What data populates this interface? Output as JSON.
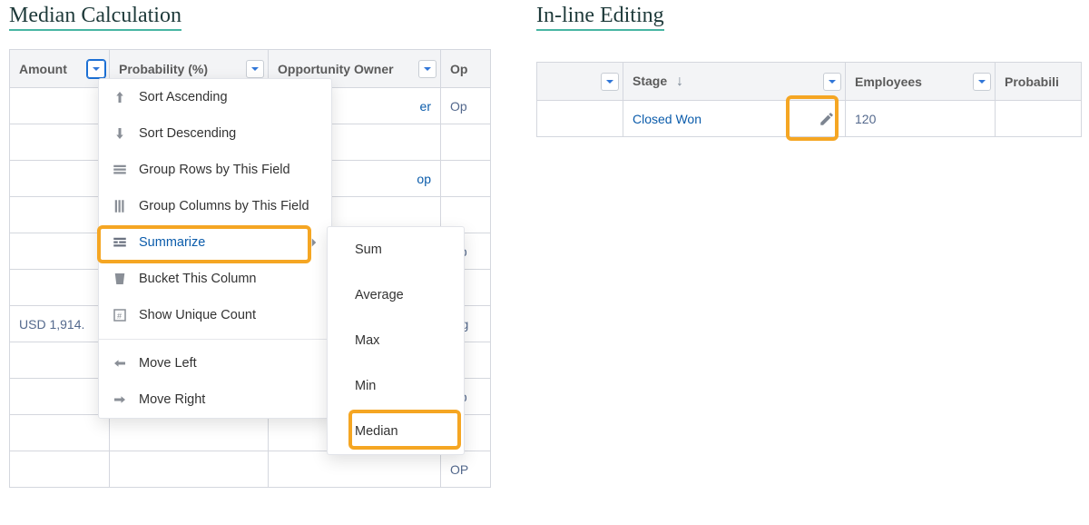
{
  "left": {
    "caption": "Median Calculation",
    "columns": {
      "amount": "Amount",
      "probability": "Probability (%)",
      "owner": "Opportunity Owner",
      "next": "Op"
    },
    "rows": [
      {
        "amount": "",
        "owner_short": "er",
        "next": "Op"
      },
      {
        "amount": "",
        "owner_short": "",
        "next": ""
      },
      {
        "amount": "",
        "owner_short": "op",
        "next": ""
      },
      {
        "amount": "",
        "owner_short": "",
        "next": ""
      },
      {
        "amount": "",
        "owner_short": "",
        "next": "Op"
      },
      {
        "amount": "",
        "owner_short": "",
        "next": ""
      },
      {
        "amount": "USD 1,914.",
        "owner_short": "",
        "next": "Big"
      },
      {
        "amount": "",
        "owner_short": "",
        "next": ""
      },
      {
        "amount": "",
        "owner_short": "",
        "next": "Op"
      },
      {
        "amount": "",
        "owner_short": "",
        "next": ""
      },
      {
        "amount": "",
        "owner_short": "",
        "next": "OP"
      }
    ],
    "menu": {
      "sort_asc": "Sort Ascending",
      "sort_desc": "Sort Descending",
      "group_rows": "Group Rows by This Field",
      "group_cols": "Group Columns by This Field",
      "summarize": "Summarize",
      "bucket": "Bucket This Column",
      "unique": "Show Unique Count",
      "move_left": "Move Left",
      "move_right": "Move Right"
    },
    "submenu": {
      "sum": "Sum",
      "average": "Average",
      "max": "Max",
      "min": "Min",
      "median": "Median"
    }
  },
  "right": {
    "caption": "In-line Editing",
    "columns": {
      "blank": "",
      "stage": "Stage",
      "employees": "Employees",
      "probability": "Probabili"
    },
    "row": {
      "stage": "Closed Won",
      "employees": "120"
    }
  }
}
